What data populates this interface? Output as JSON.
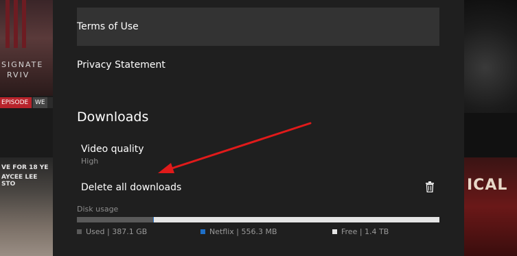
{
  "links": {
    "terms": "Terms of Use",
    "privacy": "Privacy Statement"
  },
  "downloads": {
    "title": "Downloads",
    "video_quality": {
      "label": "Video quality",
      "value": "High"
    },
    "delete_all": "Delete all downloads",
    "disk_usage": {
      "label": "Disk usage",
      "used_fraction": 0.21,
      "netflix_fraction": 0.0004,
      "legend": [
        {
          "key": "used",
          "text": "Used | 387.1 GB",
          "color": "#5a5a5a"
        },
        {
          "key": "netflix",
          "text": "Netflix | 556.3 MB",
          "color": "#1e6fc7"
        },
        {
          "key": "free",
          "text": "Free | 1.4 TB",
          "color": "#e5e5e5"
        }
      ]
    }
  },
  "background": {
    "poster_left_top_lines": [
      "SIGNATE",
      "RVIV"
    ],
    "poster_left_tag_red": "EPISODE",
    "poster_left_tag_white": "WE",
    "poster_left_bottom_lines": [
      "VE FOR 18 YE",
      "AYCEE LEE STO"
    ],
    "poster_right_bottom": "ICAL"
  },
  "colors": {
    "accent_arrow": "#e01a1a",
    "panel_bg": "#1f1f1f",
    "highlight_row": "#333333"
  }
}
